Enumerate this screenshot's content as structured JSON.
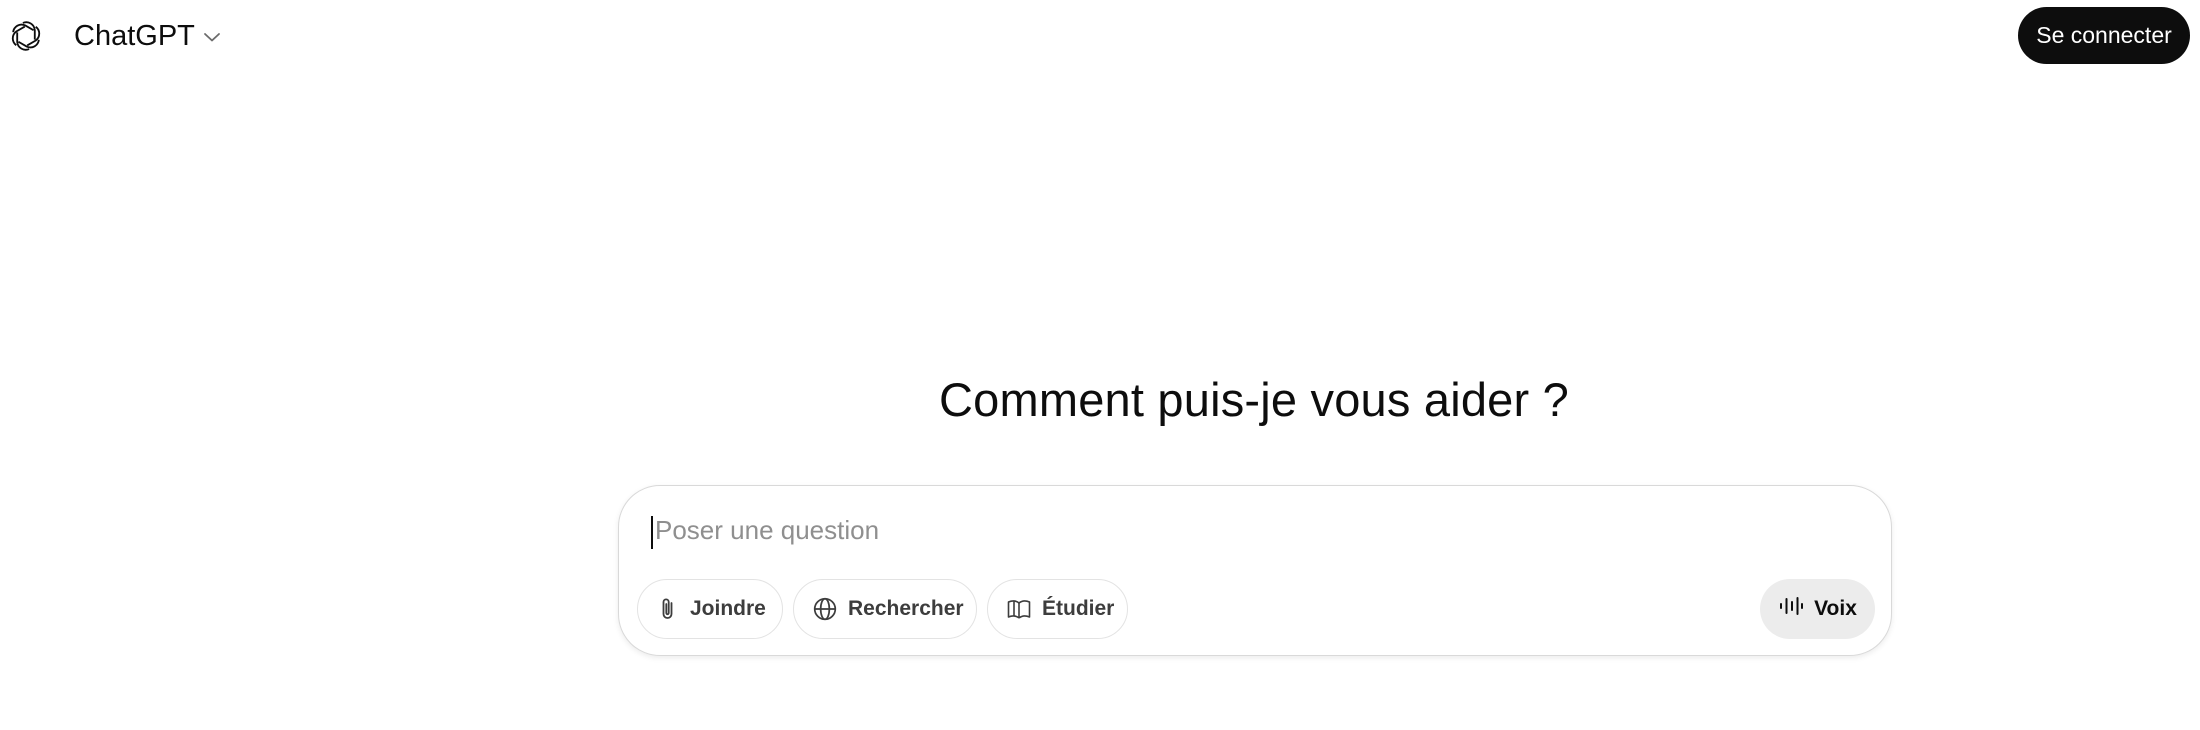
{
  "header": {
    "model_name": "ChatGPT",
    "login_label": "Se connecter",
    "logo_icon": "openai-logo-icon",
    "chevron_icon": "chevron-down-icon"
  },
  "main": {
    "headline": "Comment puis-je vous aider ?"
  },
  "composer": {
    "placeholder": "Poser une question",
    "value": "",
    "tools": [
      {
        "label": "Joindre",
        "icon": "paperclip-icon"
      },
      {
        "label": "Rechercher",
        "icon": "globe-icon"
      },
      {
        "label": "Étudier",
        "icon": "book-icon"
      }
    ],
    "voice_label": "Voix",
    "voice_icon": "voice-waveform-icon"
  },
  "colors": {
    "primary_button": "#0d0d0d",
    "voice_button_bg": "#ececec",
    "placeholder_text": "#8f8f8f",
    "border": "#d9d9d9"
  }
}
